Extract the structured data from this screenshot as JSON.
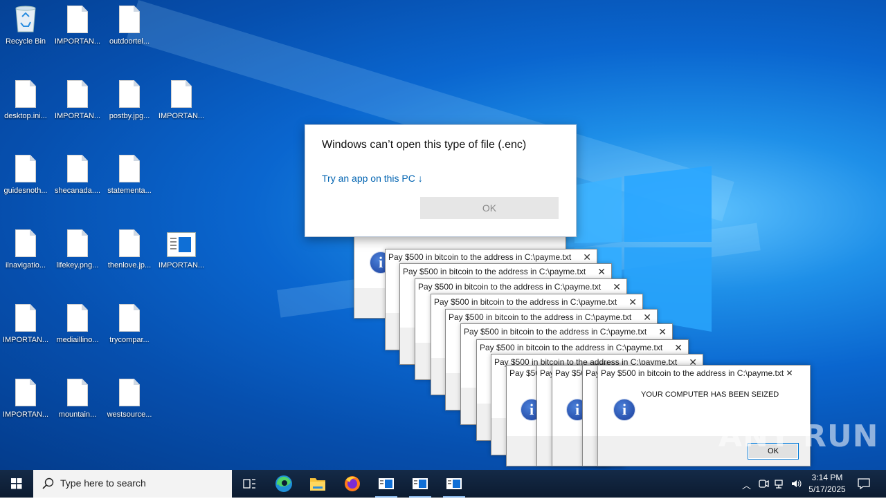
{
  "desktop": {
    "icons": [
      {
        "label": "Recycle Bin",
        "type": "bin"
      },
      {
        "label": "IMPORTAN...",
        "type": "file"
      },
      {
        "label": "outdoortel...",
        "type": "file"
      },
      {
        "label": "desktop.ini...",
        "type": "file"
      },
      {
        "label": "IMPORTAN...",
        "type": "file"
      },
      {
        "label": "postby.jpg...",
        "type": "file"
      },
      {
        "label": "IMPORTAN...",
        "type": "file"
      },
      {
        "label": "guidesnoth...",
        "type": "file"
      },
      {
        "label": "shecanada....",
        "type": "file"
      },
      {
        "label": "statementa...",
        "type": "file"
      },
      {
        "label": "ilnavigatio...",
        "type": "file"
      },
      {
        "label": "lifekey.png...",
        "type": "file"
      },
      {
        "label": "thenlove.jp...",
        "type": "file"
      },
      {
        "label": "IMPORTAN...",
        "type": "app"
      },
      {
        "label": "IMPORTAN...",
        "type": "file"
      },
      {
        "label": "mediaillino...",
        "type": "file"
      },
      {
        "label": "trycompar...",
        "type": "file"
      },
      {
        "label": "IMPORTAN...",
        "type": "file"
      },
      {
        "label": "mountain...",
        "type": "file"
      },
      {
        "label": "westsource...",
        "type": "file"
      }
    ]
  },
  "open_dialog": {
    "title": "Windows can’t open this type of file (.enc)",
    "link": "Try an app on this PC ↓",
    "ok": "OK"
  },
  "ransom_dialogs": {
    "title": "Pay $500 in bitcoin to the address in C:\\payme.txt",
    "short_title_a": "Pay $50",
    "short_title_b": "Pay",
    "short_title_c": "Pay $50",
    "short_title_d": "Pay",
    "close": "✕",
    "message": "YOUR COMPUTER HAS BEEN SEIZED",
    "ok": "OK",
    "info_glyph": "i"
  },
  "taskbar": {
    "search_placeholder": "Type here to search",
    "time": "3:14 PM",
    "date": "5/17/2025"
  },
  "watermark": "ANY RUN"
}
